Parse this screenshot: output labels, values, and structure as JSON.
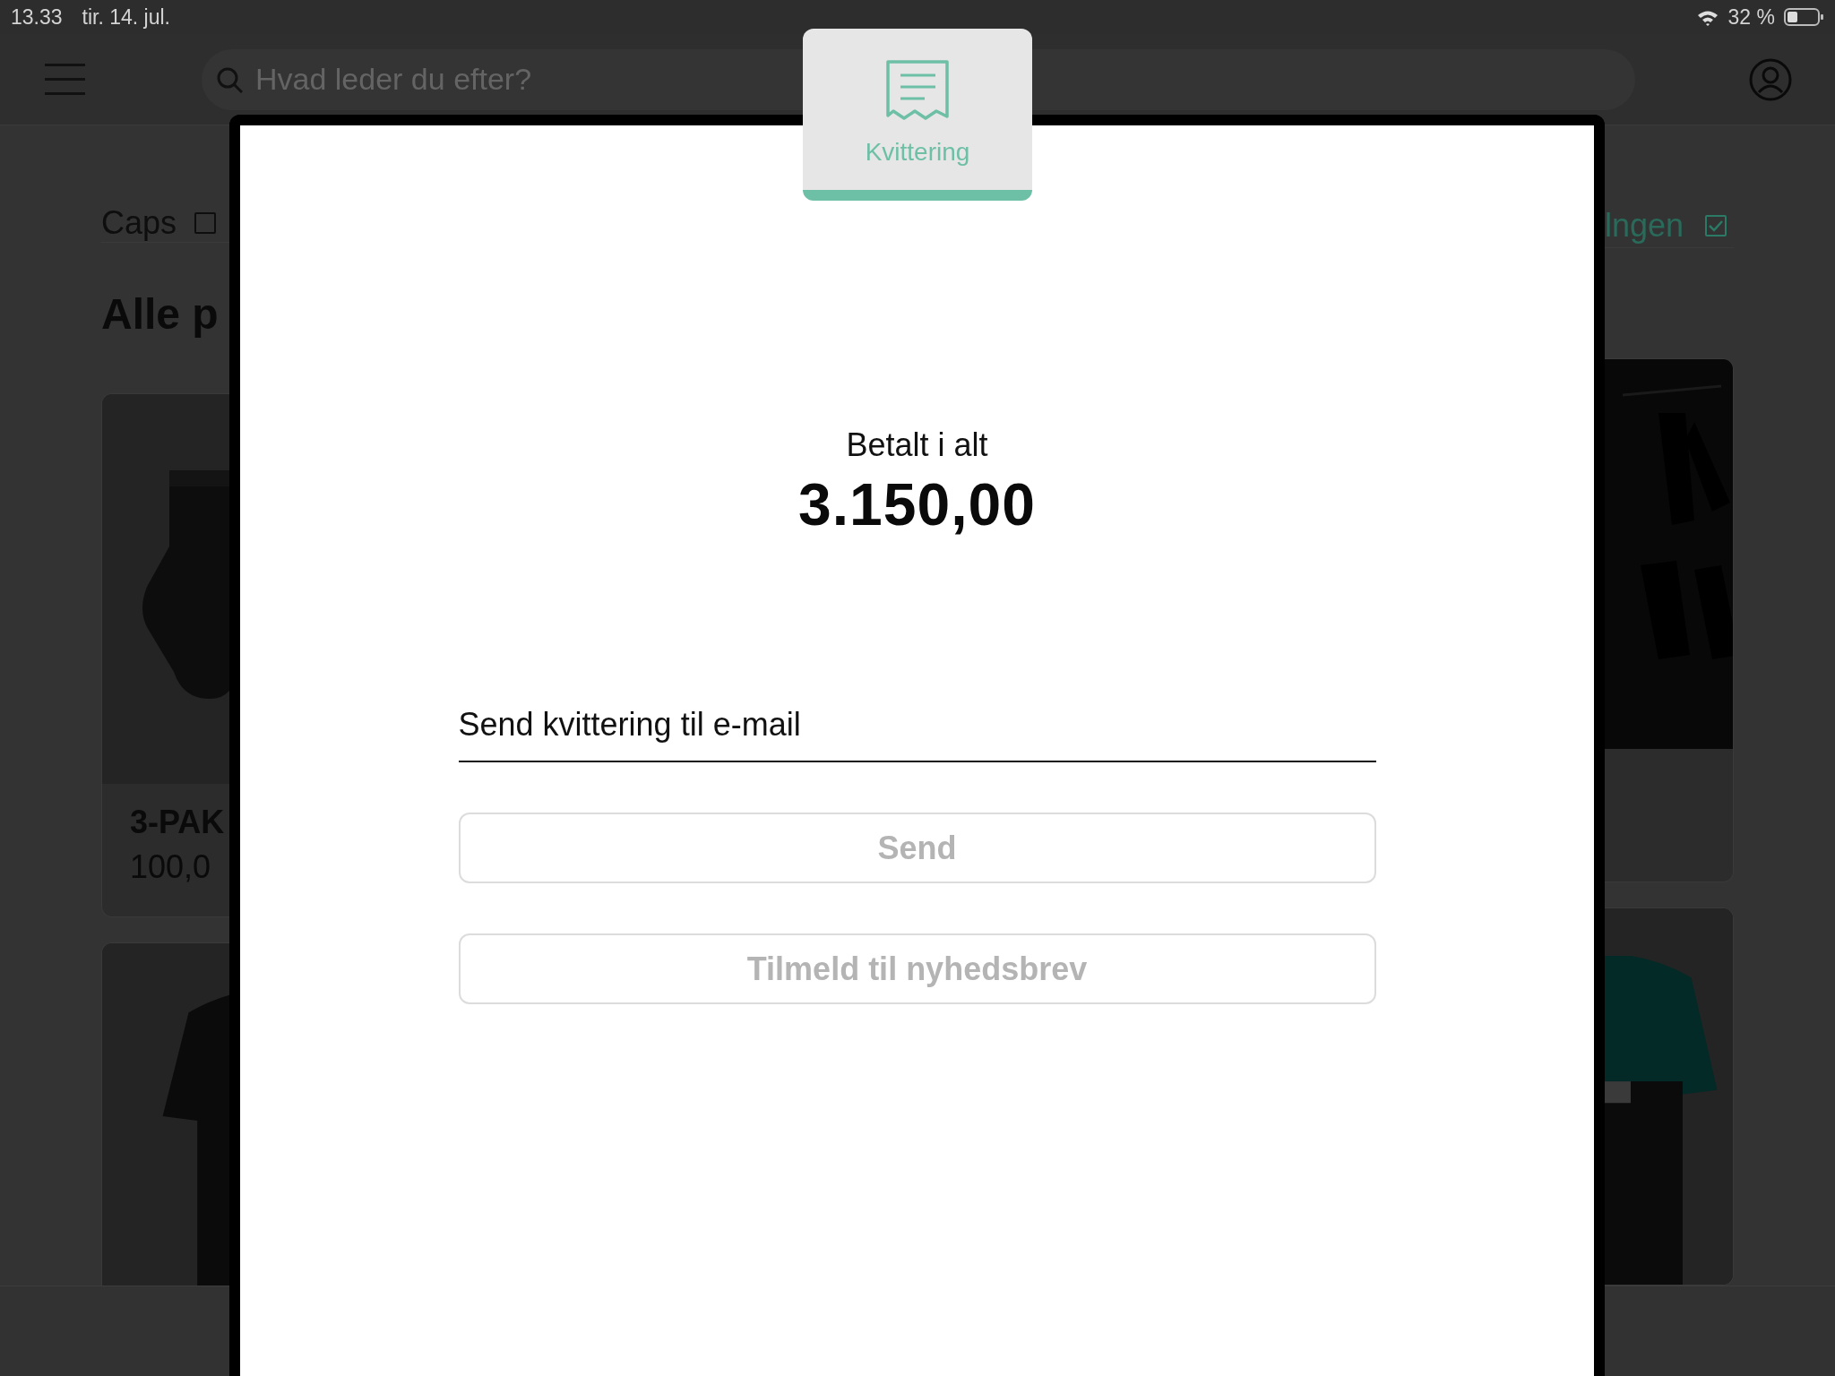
{
  "status_bar": {
    "time": "13.33",
    "date": "tir. 14. jul.",
    "battery": "32 %"
  },
  "top_bar": {
    "search": {
      "placeholder": "Hvad leder du efter?"
    }
  },
  "left_column": {
    "filter": {
      "label": "Caps",
      "checked": false
    },
    "heading": "Alle p",
    "cards": [
      {
        "kind": "product",
        "name": "3-PAK",
        "price": "100,0"
      },
      {
        "kind": "picture"
      }
    ]
  },
  "right_column": {
    "filter": {
      "label": "lngen",
      "checked": true
    },
    "cards": [
      {
        "kind": "product"
      },
      {
        "kind": "picture"
      }
    ]
  },
  "modal": {
    "tab": {
      "label": "Kvittering",
      "selected": true
    },
    "total_label": "Betalt i alt",
    "total": "3.150,00",
    "email": {
      "placeholder": "Send kvittering til e-mail"
    },
    "buttons": [
      {
        "label": "Send",
        "disabled": true
      },
      {
        "label": "Tilmeld til nyhedsbrev",
        "disabled": true
      }
    ]
  }
}
